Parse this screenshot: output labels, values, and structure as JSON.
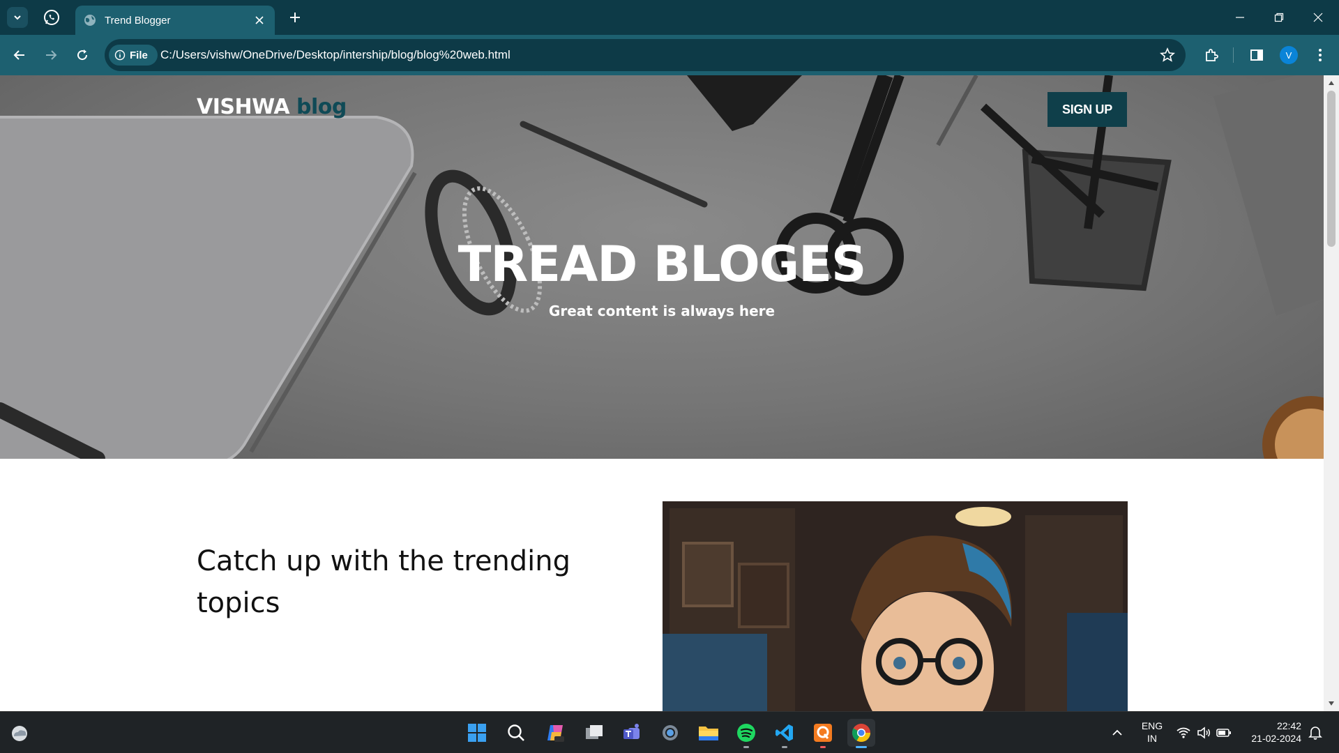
{
  "browser": {
    "tab_title": "Trend Blogger",
    "url_chip": "File",
    "url": "C:/Users/vishw/OneDrive/Desktop/intership/blog/blog%20web.html",
    "profile_initial": "V"
  },
  "page": {
    "brand": {
      "name": "VISHWA",
      "accent": "blog"
    },
    "signup_label": "SIGN UP",
    "hero_title": "TREAD BLOGES",
    "hero_subtitle": "Great content is always here",
    "section_heading": "Catch up with the trending topics"
  },
  "taskbar": {
    "language": "ENG",
    "region": "IN",
    "time": "22:42",
    "date": "21-02-2024"
  },
  "colors": {
    "chrome_dark": "#0d3a47",
    "chrome_mid": "#1d6070",
    "brand_accent": "#0f4a56",
    "signup_bg": "#0f3f4a"
  },
  "icons": [
    "chevron-down-icon",
    "whatsapp-icon",
    "globe-icon",
    "close-icon",
    "plus-icon",
    "minimize-icon",
    "restore-icon",
    "back-icon",
    "forward-icon",
    "reload-icon",
    "info-icon",
    "star-icon",
    "extensions-icon",
    "sidepanel-icon",
    "menu-icon",
    "windows-icon",
    "search-icon",
    "copilot-icon",
    "task-view-icon",
    "teams-icon",
    "settings-icon",
    "file-explorer-icon",
    "spotify-icon",
    "vscode-icon",
    "q-app-icon",
    "chrome-icon",
    "weather-icon",
    "wifi-icon",
    "volume-icon",
    "battery-icon",
    "notification-icon"
  ]
}
